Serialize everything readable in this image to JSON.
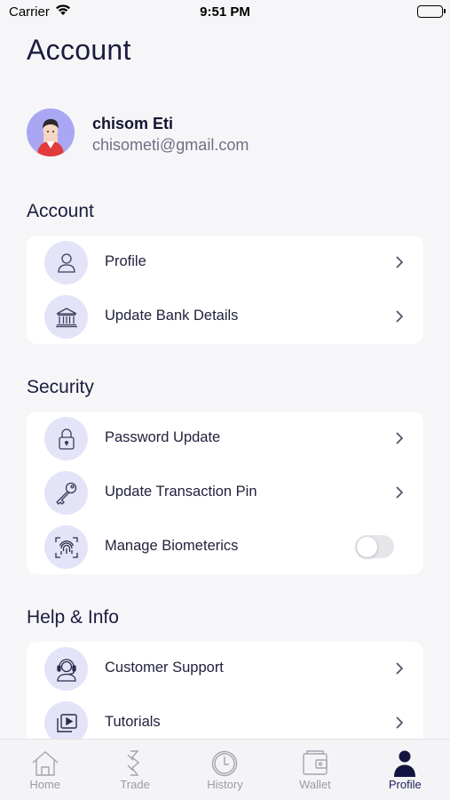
{
  "status_bar": {
    "carrier": "Carrier",
    "time": "9:51 PM"
  },
  "page": {
    "title": "Account"
  },
  "user": {
    "name": "chisom Eti",
    "email": "chisometi@gmail.com"
  },
  "sections": {
    "account": {
      "title": "Account",
      "items": [
        {
          "label": "Profile",
          "icon": "user-outline-icon"
        },
        {
          "label": "Update Bank Details",
          "icon": "bank-icon"
        }
      ]
    },
    "security": {
      "title": "Security",
      "items": [
        {
          "label": "Password Update",
          "icon": "lock-icon"
        },
        {
          "label": "Update Transaction Pin",
          "icon": "key-icon"
        },
        {
          "label": "Manage Biometerics",
          "icon": "fingerprint-icon",
          "toggle": false
        }
      ]
    },
    "help": {
      "title": "Help & Info",
      "items": [
        {
          "label": "Customer Support",
          "icon": "headset-icon"
        },
        {
          "label": "Tutorials",
          "icon": "video-library-icon"
        }
      ]
    }
  },
  "tabs": [
    {
      "label": "Home",
      "icon": "home-icon"
    },
    {
      "label": "Trade",
      "icon": "trade-icon"
    },
    {
      "label": "History",
      "icon": "clock-icon"
    },
    {
      "label": "Wallet",
      "icon": "wallet-icon"
    },
    {
      "label": "Profile",
      "icon": "person-icon",
      "active": true
    }
  ],
  "colors": {
    "background": "#f6f6f8",
    "card": "#ffffff",
    "icon_circle": "#e4e4f8",
    "accent": "#1f1f5a",
    "avatar_bg": "#a9a6f4",
    "tab_inactive": "#9a9aa6"
  }
}
